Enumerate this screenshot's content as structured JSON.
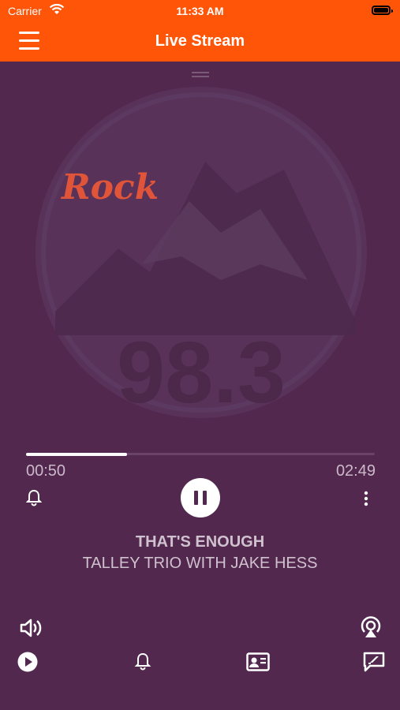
{
  "status_bar": {
    "carrier": "Carrier",
    "time": "11:33 AM"
  },
  "header": {
    "title": "Live Stream",
    "menu_icon": "hamburger-menu-icon"
  },
  "artwork": {
    "text": "Rock",
    "number": "98.3"
  },
  "player": {
    "elapsed": "00:50",
    "duration": "02:49",
    "progress": 0.29,
    "song_title": "THAT'S ENOUGH",
    "artist": "TALLEY TRIO WITH JAKE HESS"
  },
  "colors": {
    "accent": "#ff5508",
    "background": "#52284f",
    "text": "#cfc1cd"
  }
}
